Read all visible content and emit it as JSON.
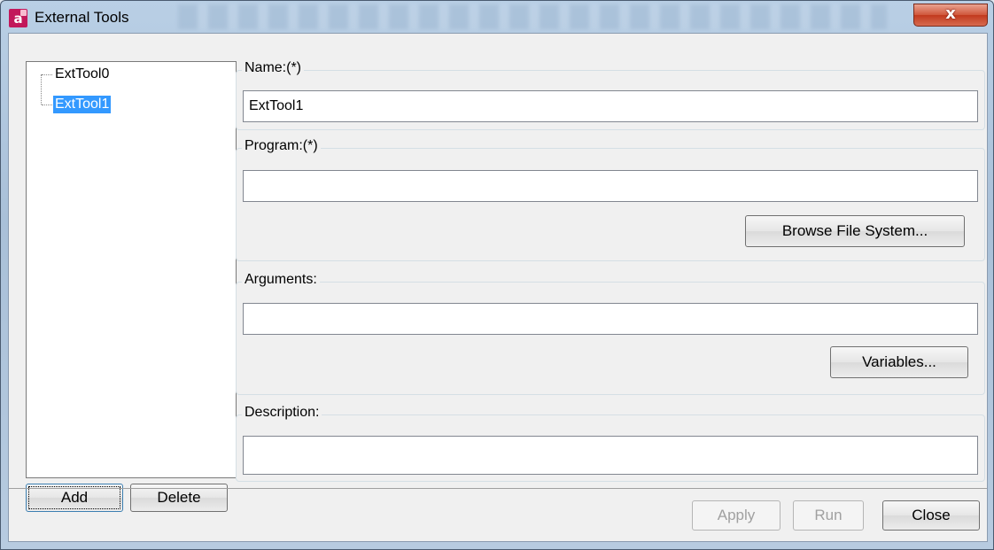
{
  "window": {
    "title": "External Tools",
    "icon": "app-icon",
    "app_icon_letter": "a",
    "close_label": "x"
  },
  "tree": {
    "items": [
      {
        "label": "ExtTool0",
        "selected": false
      },
      {
        "label": "ExtTool1",
        "selected": true
      }
    ],
    "add_label": "Add",
    "delete_label": "Delete"
  },
  "form": {
    "name": {
      "label": "Name:(*)",
      "value": "ExtTool1"
    },
    "program": {
      "label": "Program:(*)",
      "value": "",
      "browse_label": "Browse File System..."
    },
    "arguments": {
      "label": "Arguments:",
      "value": "",
      "variables_label": "Variables..."
    },
    "description": {
      "label": "Description:",
      "value": ""
    }
  },
  "footer": {
    "apply_label": "Apply",
    "run_label": "Run",
    "close_label": "Close"
  },
  "colors": {
    "selection": "#3399ff",
    "close_button": "#c8452a"
  }
}
